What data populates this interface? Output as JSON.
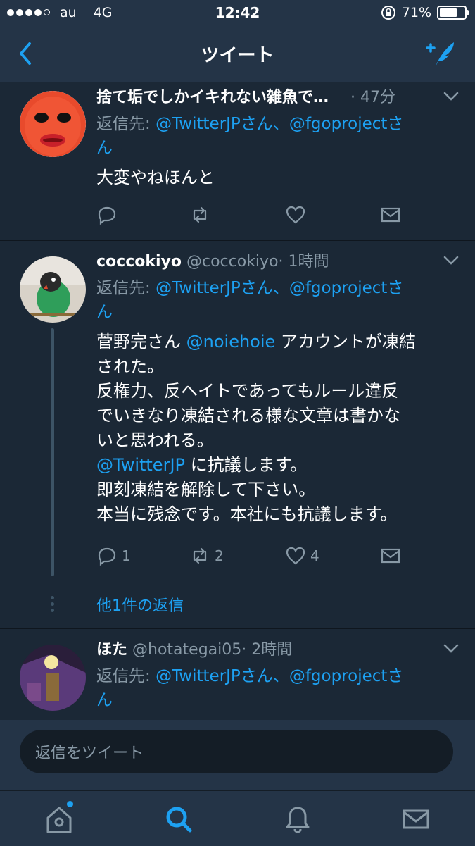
{
  "status_bar": {
    "carrier": "au",
    "network": "4G",
    "time": "12:42",
    "battery": "71%",
    "signal_bars": 4,
    "battery_level": 0.71
  },
  "nav": {
    "title": "ツイート"
  },
  "tweets": [
    {
      "name": "捨て垢でしかイキれない雑魚で…",
      "handle": "",
      "time": "· 47分",
      "reply_label": "返信先: ",
      "reply_to_1": "@TwitterJPさん、",
      "reply_to_2": "@fgoprojectさ",
      "reply_to_3": "ん",
      "text_1": "大変やねほんと"
    },
    {
      "name": "coccokiyo",
      "handle": "@coccokiyo",
      "time": "· 1時間",
      "reply_label": "返信先: ",
      "reply_to_1": "@TwitterJPさん、",
      "reply_to_2": "@fgoprojectさ",
      "reply_to_3": "ん",
      "text_1a": "菅野完さん ",
      "mention_1": "@noiehoie",
      "text_1b": " アカウントが凍結",
      "text_2": "された。",
      "text_3": "反権力、反ヘイトであってもルール違反",
      "text_4": "でいきなり凍結される様な文章は書かな",
      "text_5": "いと思われる。",
      "mention_2": "@TwitterJP",
      "text_6b": " に抗議します。",
      "text_7": "即刻凍結を解除して下さい。",
      "text_8": "本当に残念です。本社にも抗議します。",
      "replies": "1",
      "retweets": "2",
      "likes": "4",
      "more_replies": "他1件の返信"
    },
    {
      "name": "ほた",
      "handle": "@hotategai05",
      "time": "· 2時間",
      "reply_label": "返信先: ",
      "reply_to_1": "@TwitterJPさん、",
      "reply_to_2": "@fgoprojectさ",
      "reply_to_3": "ん"
    }
  ],
  "reply_box": {
    "placeholder": "返信をツイート"
  },
  "tabs": [
    "home-icon",
    "search-icon",
    "bell-icon",
    "mail-icon"
  ],
  "colors": {
    "accent": "#1da1f2",
    "bg": "#1b2836",
    "bar": "#243447",
    "muted": "#8899a6"
  }
}
